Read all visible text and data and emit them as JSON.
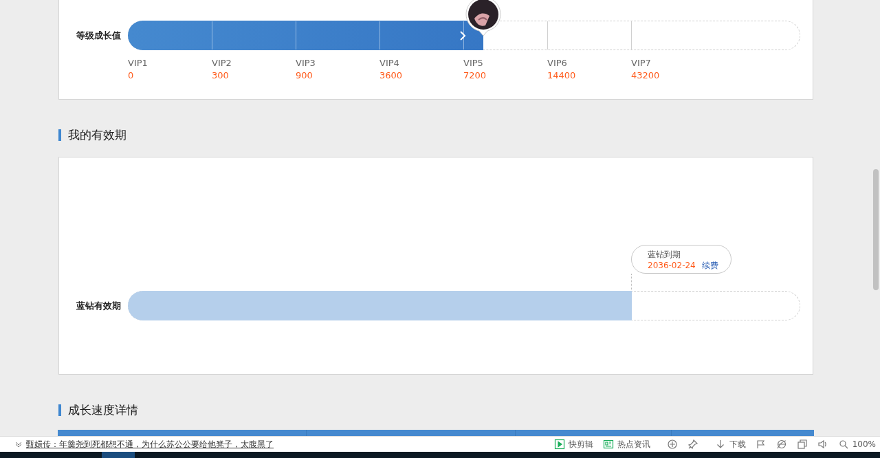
{
  "growth": {
    "label": "等级成长值",
    "level": 0.529,
    "tiers": [
      {
        "name": "VIP1",
        "points": "0"
      },
      {
        "name": "VIP2",
        "points": "300"
      },
      {
        "name": "VIP3",
        "points": "900"
      },
      {
        "name": "VIP4",
        "points": "3600"
      },
      {
        "name": "VIP5",
        "points": "7200"
      },
      {
        "name": "VIP6",
        "points": "14400"
      },
      {
        "name": "VIP7",
        "points": "43200"
      }
    ]
  },
  "validity": {
    "title": "我的有效期",
    "label": "蓝钻有效期",
    "level": 0.75,
    "tooltip": {
      "title": "蓝钻到期",
      "date": "2036-02-24",
      "link": "续费"
    }
  },
  "speed": {
    "title": "成长速度详情"
  },
  "status_bar": {
    "headline": "甄嬛传：年羹尧到死都想不通，为什么苏公公要给他凳子，太腹黑了",
    "items": [
      {
        "kind": "clip",
        "label": "快剪辑"
      },
      {
        "kind": "news",
        "label": "热点资讯"
      },
      {
        "kind": "speed"
      },
      {
        "kind": "pin"
      },
      {
        "kind": "download",
        "label": "下载"
      },
      {
        "kind": "flag"
      },
      {
        "kind": "browser"
      },
      {
        "kind": "window"
      },
      {
        "kind": "sound"
      },
      {
        "kind": "zoom",
        "label": "100%"
      }
    ]
  }
}
